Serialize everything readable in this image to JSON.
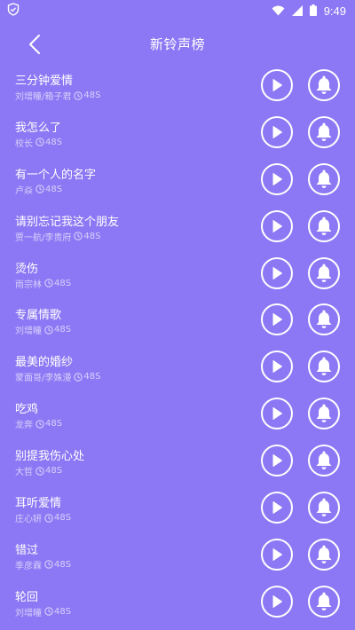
{
  "status_bar": {
    "time": "9:49"
  },
  "header": {
    "title": "新铃声榜"
  },
  "songs": [
    {
      "title": "三分钟爱情",
      "artist": "刘增瞳/箱子君",
      "duration": "48S"
    },
    {
      "title": "我怎么了",
      "artist": "校长",
      "duration": "48S"
    },
    {
      "title": "有一个人的名字",
      "artist": "卢焱",
      "duration": "48S"
    },
    {
      "title": "请别忘记我这个朋友",
      "artist": "贾一航/李贵府",
      "duration": "48S"
    },
    {
      "title": "烫伤",
      "artist": "雨宗林",
      "duration": "48S"
    },
    {
      "title": "专属情歌",
      "artist": "刘增瞳",
      "duration": "48S"
    },
    {
      "title": "最美的婚纱",
      "artist": "蒙面哥/李姝漫",
      "duration": "48S"
    },
    {
      "title": "吃鸡",
      "artist": "龙奔",
      "duration": "48S"
    },
    {
      "title": "别提我伤心处",
      "artist": "大哲",
      "duration": "48S"
    },
    {
      "title": "耳听爱情",
      "artist": "庄心妍",
      "duration": "48S"
    },
    {
      "title": "错过",
      "artist": "季彦霖",
      "duration": "48S"
    },
    {
      "title": "轮回",
      "artist": "刘增瞳",
      "duration": "48S"
    }
  ]
}
